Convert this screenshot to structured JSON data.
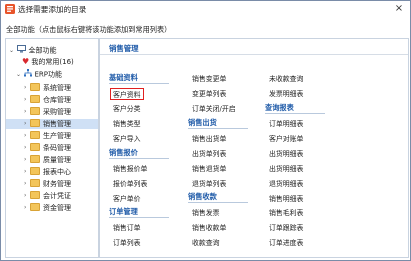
{
  "window": {
    "title": "选择需要添加的目录",
    "close": "×"
  },
  "hint": "全部功能（点击鼠标右键将该功能添加到常用列表）",
  "tree": {
    "root": "全部功能",
    "favorites": "我的常用(16)",
    "erp": "ERP功能",
    "modules": [
      "系统管理",
      "仓库管理",
      "采购管理",
      "销售管理",
      "生产管理",
      "条码管理",
      "质量管理",
      "报表中心",
      "财务管理",
      "会计凭证",
      "资金管理"
    ],
    "selected_index": 3
  },
  "panel": {
    "section_title": "销售管理",
    "categories": {
      "basic": "基础资料",
      "quote": "销售报价",
      "order": "订单管理",
      "outbound": "销售出货",
      "collection": "销售收款",
      "query": "查询报表"
    },
    "col1": {
      "basic_items": [
        "客户资料",
        "客户分类",
        "销售类型",
        "客户导入"
      ],
      "quote_items": [
        "销售报价单",
        "报价单列表",
        "客户单价"
      ],
      "order_items": [
        "销售订单",
        "订单列表"
      ]
    },
    "col2": {
      "top_items": [
        "销售变更单",
        "变更单列表",
        "订单关闭/开启"
      ],
      "outbound_items": [
        "销售出货单",
        "出货单列表",
        "销售退货单",
        "退货单列表"
      ],
      "collection_items": [
        "销售发票",
        "销售收款单",
        "收款查询"
      ]
    },
    "col3": {
      "top_items": [
        "未收款查询",
        "发票明细表"
      ],
      "query_items": [
        "订单明细表",
        "客户对账单",
        "出货明细表",
        "出货明细表",
        "退货明细表",
        "销售明细表",
        "销售毛利表",
        "订单跟踪表",
        "订单进度表"
      ]
    },
    "highlighted_item": "客户资料"
  }
}
